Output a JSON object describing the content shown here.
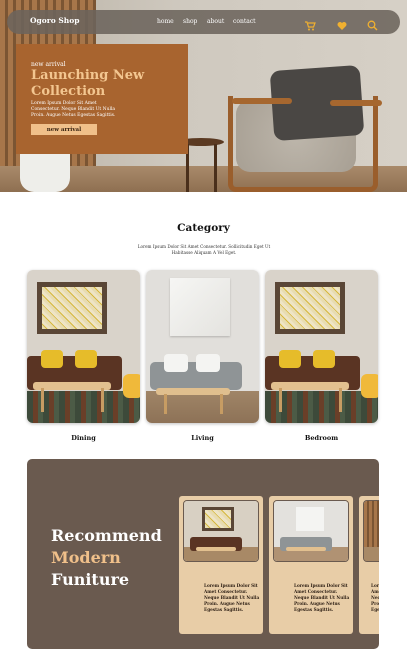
{
  "nav": {
    "brand": "Ogoro Shop",
    "links": [
      "home",
      "shop",
      "about",
      "contact"
    ],
    "icons": [
      "cart-icon",
      "heart-icon",
      "search-icon"
    ]
  },
  "hero": {
    "tag": "new arrival",
    "title": "Launching New Collection",
    "text": "Lorem Ipsum Dolor Sit Amet Consectetur. Neque Blandit Ut Nulla Proin. Augue Netus Egestas Sagittis.",
    "button": "new arrival"
  },
  "category": {
    "title": "Category",
    "subtitle": "Lorem Ipsum Dolor Sit Amet Consectetur. Sollicitudin Eget Ut Habitasse Aliquam A Vel Eget.",
    "items": [
      "Dining",
      "Living",
      "Bedroom"
    ]
  },
  "recommend": {
    "title_line1": "Recommend",
    "title_line2": "Modern",
    "title_line3": "Funiture",
    "cards": [
      {
        "text": "Lorem Ipsum Dolor Sit Amet Consectetur. Neque Blandit Ut Nulla Proin. Augue Netus Egestas Sagittis."
      },
      {
        "text": "Lorem Ipsum Dolor Sit Amet Consectetur. Neque Blandit Ut Nulla Proin. Augue Netus Egestas Sagittis."
      },
      {
        "text": "Lorem Ipsum Dolor Sit Amet Consectetur. Neque Blandit Ut Nulla Proin. Augue Netus Egestas Sagittis."
      }
    ]
  },
  "colors": {
    "brand": "#a8642f",
    "accent": "#f0c08a",
    "dark": "#6a5a4f"
  }
}
